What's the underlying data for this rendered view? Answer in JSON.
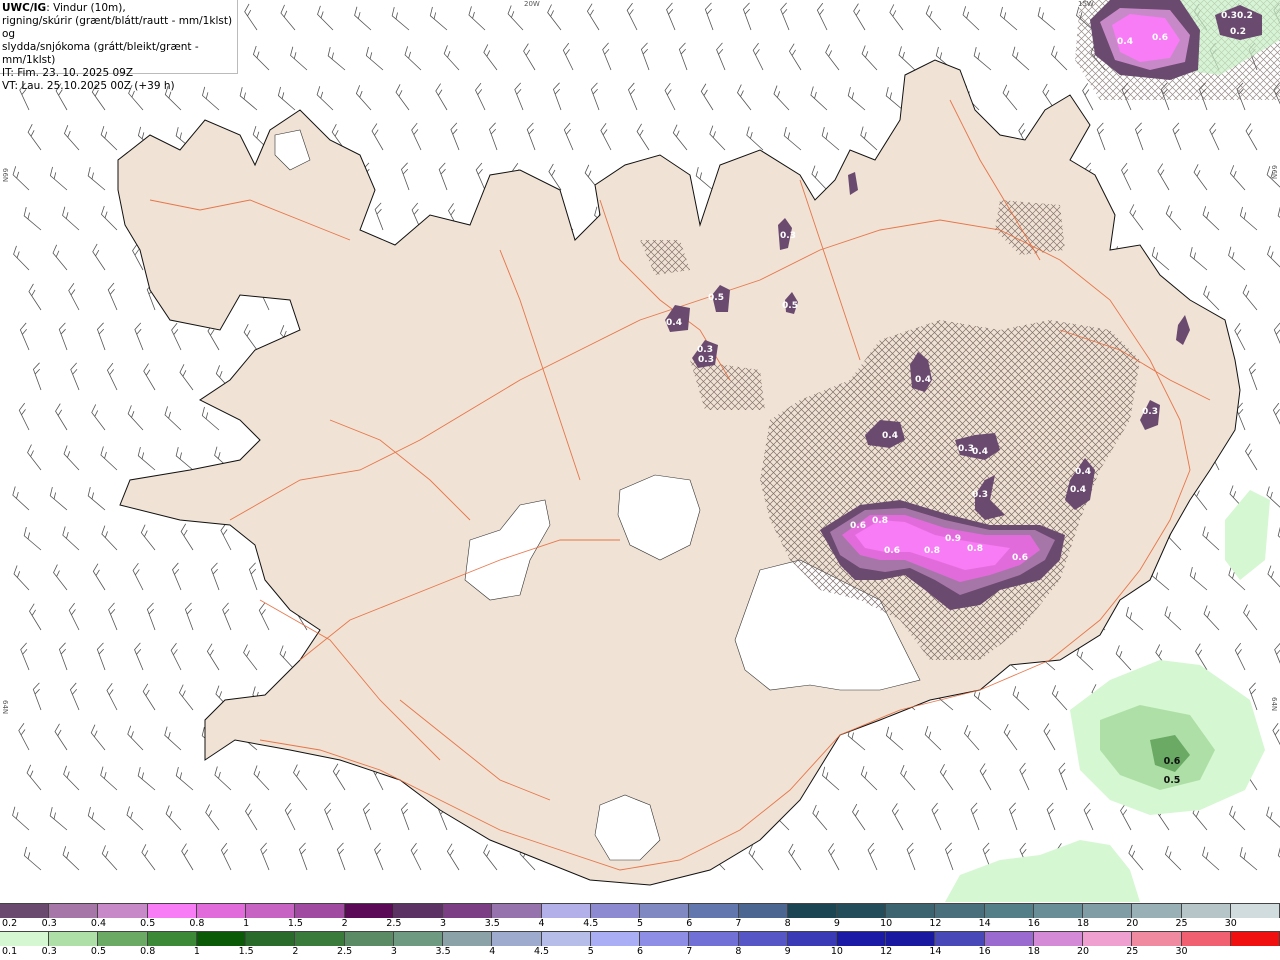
{
  "header": {
    "model": "UWC/IG",
    "line1": ": Vindur (10m),",
    "line2": "rigning/skúrir (grænt/blátt/rautt - mm/1klst) og",
    "line3": "slydda/snjókoma (grátt/bleikt/grænt - mm/1klst)",
    "issue": "IT: Fim. 23. 10. 2025 09Z",
    "valid": "VT: Lau. 25.10.2025 00Z (+39 h)"
  },
  "graticule": {
    "top_a": "20W",
    "top_b": "15W",
    "left_a": "66N",
    "left_b": "64N",
    "right_a": "66N",
    "right_b": "64N"
  },
  "precip_labels": [
    "0.4",
    "0.6",
    "0.30.2",
    "0.2",
    "0.4",
    "0.5",
    "0.3",
    "0.3",
    "0.5",
    "0.4",
    "0.3",
    "0.4",
    "0.6",
    "0.8",
    "0.6",
    "0.8",
    "0.9",
    "0.8",
    "0.6",
    "0.3",
    "0.4",
    "0.3",
    "0.4",
    "0.4",
    "0.3",
    "0.6",
    "0.5"
  ],
  "snow_scale": {
    "labels": [
      "0.2",
      "0.3",
      "0.4",
      "0.5",
      "0.8",
      "1",
      "1.5",
      "2",
      "2.5",
      "3",
      "3.5",
      "4",
      "4.5",
      "5",
      "6",
      "7",
      "8",
      "9",
      "10",
      "12",
      "14",
      "16",
      "18",
      "20",
      "25",
      "30"
    ],
    "colors": [
      "#6a4a6e",
      "#a776a8",
      "#c889c8",
      "#f77cf5",
      "#e26bdc",
      "#c763c3",
      "#a14aa2",
      "#5a0a57",
      "#5c3163",
      "#7b3d83",
      "#9773ae",
      "#b3afe9",
      "#8d8ad1",
      "#8089c2",
      "#6277ad",
      "#4b6690",
      "#1b4553",
      "#244d5c",
      "#3b6470",
      "#486f7b",
      "#547f88",
      "#6a8e97",
      "#809da5",
      "#98b0b6",
      "#b5c5c8",
      "#d0dcde"
    ]
  },
  "rain_scale": {
    "labels": [
      "0.1",
      "0.3",
      "0.5",
      "0.8",
      "1",
      "1.5",
      "2",
      "2.5",
      "3",
      "3.5",
      "4",
      "4.5",
      "5",
      "6",
      "7",
      "8",
      "9",
      "10",
      "12",
      "14",
      "16",
      "18",
      "20",
      "25",
      "30"
    ],
    "colors": [
      "#d5f7d2",
      "#aedfa6",
      "#6aaa64",
      "#3c8a37",
      "#0a5a07",
      "#2a6a2a",
      "#3a7a3a",
      "#5a8b65",
      "#6f9a82",
      "#8aa2a8",
      "#9eabce",
      "#b6bde8",
      "#a9aef5",
      "#8e8ee6",
      "#7070d6",
      "#5656c6",
      "#3a3ab6",
      "#1a1aa6",
      "#1818a0",
      "#4848b8",
      "#9a6ad0",
      "#d58ad8",
      "#f0a0d0",
      "#f08aa0",
      "#f06070",
      "#f01010"
    ]
  },
  "colors": {
    "land": "#f0e2d4",
    "road": "#e66a3b",
    "glacier": "#ffffff",
    "barb": "#555555"
  }
}
